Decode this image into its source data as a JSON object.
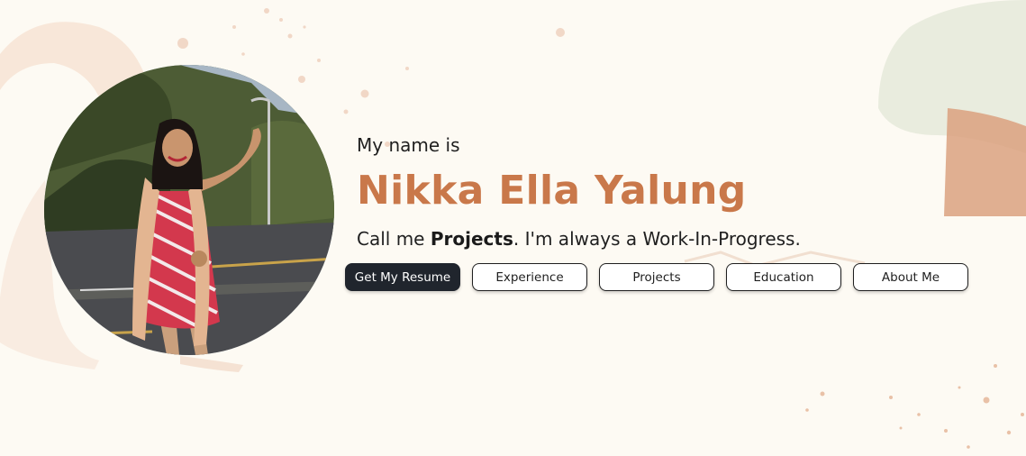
{
  "hero": {
    "greeting": "My name is",
    "name": "Nikka Ella Yalung",
    "tagline_prefix": "Call me ",
    "tagline_emphasis": "Projects",
    "tagline_suffix": ". I'm always a Work-In-Progress.",
    "photo_alt": "Nikka Ella Yalung"
  },
  "buttons": {
    "resume": "Get My Resume",
    "experience": "Experience",
    "projects": "Projects",
    "education": "Education",
    "about": "About Me"
  },
  "colors": {
    "background": "#fdfaf3",
    "accent": "#c9784a",
    "primary_button": "#20252d",
    "text": "#1f1f1f"
  }
}
